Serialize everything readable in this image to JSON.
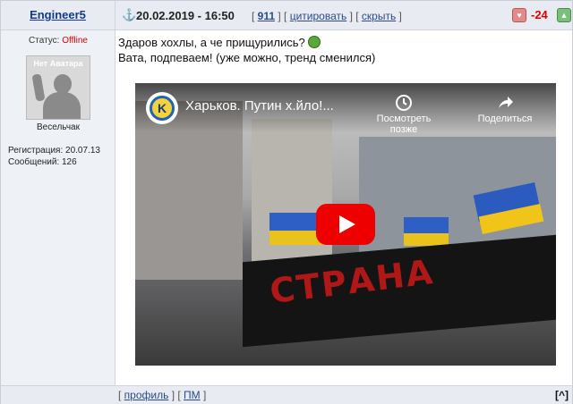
{
  "header": {
    "author": "Engineer5",
    "datetime": "20.02.2019 - 16:50",
    "reply_count": "911",
    "quote_label": "цитировать",
    "hide_label": "скрыть",
    "score": "-24"
  },
  "sidebar": {
    "status_label": "Статус: ",
    "status_value": "Offline",
    "avatar_text": "Нет Аватара",
    "rank": "Весельчак",
    "registration": "Регистрация: 20.07.13",
    "messages": "Сообщений: 126"
  },
  "post": {
    "line1": "Здаров хохлы, а че прищурились?",
    "line2": "Вата, подпеваем! (уже можно, тренд сменился)"
  },
  "video": {
    "title": "Харьков. Путин х.йло!...",
    "channel_logo": "K",
    "watch_later": "Посмотреть позже",
    "share": "Поделиться",
    "banner_text": "СТРАНА"
  },
  "footer": {
    "profile_label": "профиль",
    "pm_label": "ПМ",
    "up_label": "[^]"
  },
  "colors": {
    "accent": "#123a8c",
    "danger": "#d00",
    "youtube": "#e00"
  }
}
